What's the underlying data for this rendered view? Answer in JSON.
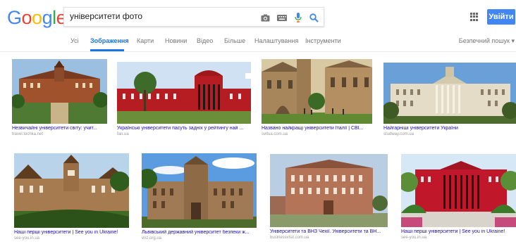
{
  "logo": {
    "letters": [
      "G",
      "o",
      "o",
      "g",
      "l",
      "e"
    ],
    "colors": [
      "#4285f4",
      "#ea4335",
      "#fbbc05",
      "#4285f4",
      "#34a853",
      "#ea4335"
    ]
  },
  "search": {
    "query": "університети фото"
  },
  "header": {
    "signin_label": "Увійти"
  },
  "tabs": [
    {
      "label": "Усі",
      "active": false
    },
    {
      "label": "Зображення",
      "active": true
    },
    {
      "label": "Карти",
      "active": false
    },
    {
      "label": "Новини",
      "active": false
    },
    {
      "label": "Відео",
      "active": false
    },
    {
      "label": "Більше",
      "active": false
    },
    {
      "label": "Налаштування",
      "active": false
    },
    {
      "label": "Інструменти",
      "active": false
    }
  ],
  "safe_search": "Безпечний пошук ▾",
  "results": [
    {
      "title": "Незвичайні університети світу: учит...",
      "domain": "travel.tochka.net"
    },
    {
      "title": "Українські університети пасуть задніх у рейтингу най ...",
      "domain": "fan.ua"
    },
    {
      "title": "Названо найкращі університети Італії | СВІ...",
      "domain": "svitua.com.ua"
    },
    {
      "title": "Найгарніші університети України",
      "domain": "studway.com.ua"
    },
    {
      "title": "Наші перші університети | See you in Ukraine!",
      "domain": "see-you.in.ua"
    },
    {
      "title": "Львівський державний університет безпеки ж...",
      "domain": "vnz.org.ua"
    },
    {
      "title": "Університети та ВНЗ Чехії. Університети та ВН...",
      "domain": "businessvisit.com.ua"
    },
    {
      "title": "Наші перші університети | See you in Ukraine!",
      "domain": "see-you.in.ua"
    }
  ]
}
